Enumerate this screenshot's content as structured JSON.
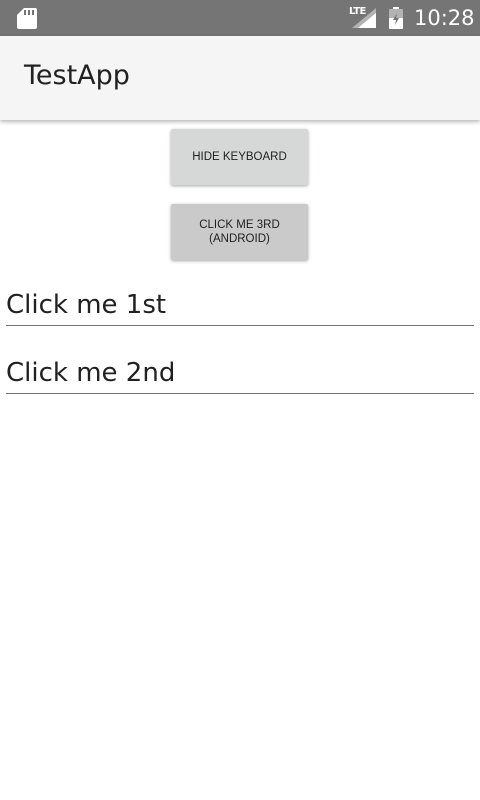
{
  "status_bar": {
    "network_type": "LTE",
    "time": "10:28",
    "background_color": "#757575",
    "icons": [
      "sd-card-icon",
      "signal-icon",
      "battery-icon"
    ]
  },
  "app_bar": {
    "title": "TestApp",
    "background_color": "#f5f5f5"
  },
  "buttons": {
    "hide_keyboard_label": "HIDE KEYBOARD",
    "click_me_third_label": "CLICK ME 3RD\n(ANDROID)"
  },
  "fields": {
    "first_value": "Click me 1st",
    "second_value": "Click me 2nd"
  }
}
